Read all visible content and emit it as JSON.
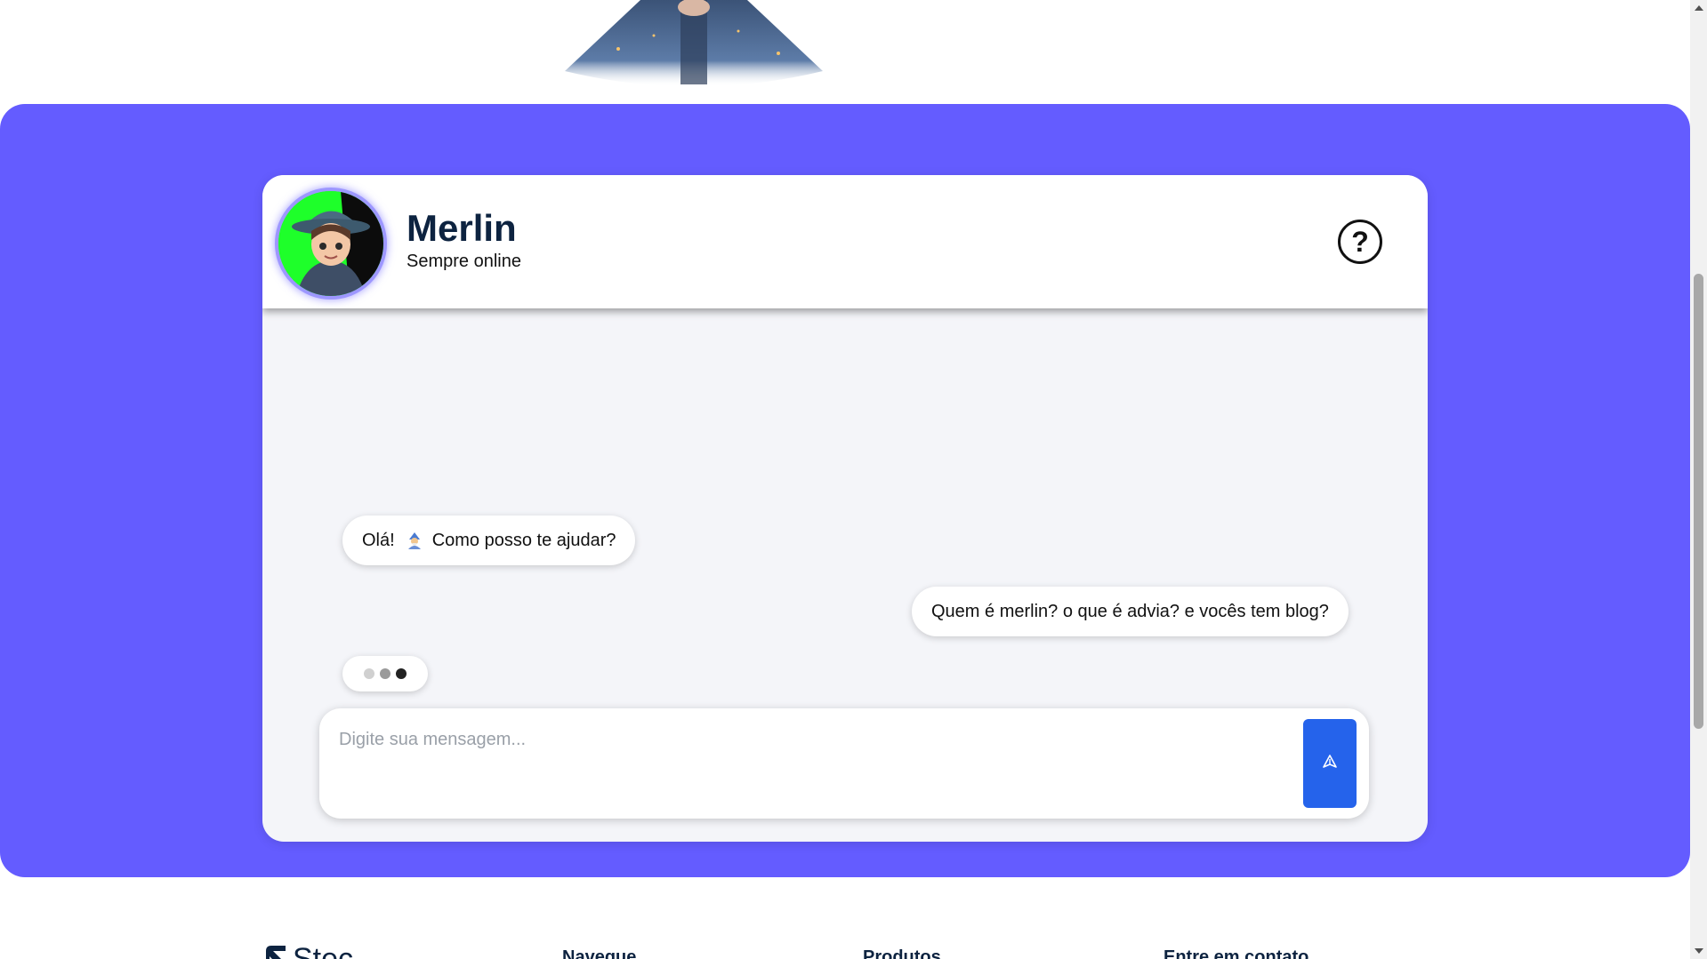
{
  "chat": {
    "bot_name": "Merlin",
    "bot_status": "Sempre online",
    "help_icon": "question-circle-icon"
  },
  "messages": [
    {
      "from": "bot",
      "text_before": "Olá!",
      "emoji": "wizard-emoji",
      "text_after": "Como posso te ajudar?"
    },
    {
      "from": "user",
      "text": "Quem é merlin? o que é advia? e vocês tem blog?"
    }
  ],
  "typing_indicator": {
    "visible": true
  },
  "composer": {
    "placeholder": "Digite sua mensagem...",
    "value": "",
    "send_icon": "send-icon"
  },
  "footer": {
    "logo_text": "Stec",
    "columns": [
      "Navegue",
      "Produtos",
      "Entre em contato"
    ]
  },
  "colors": {
    "band": "#645cff",
    "send_button": "#2563eb",
    "title": "#0d2340"
  }
}
